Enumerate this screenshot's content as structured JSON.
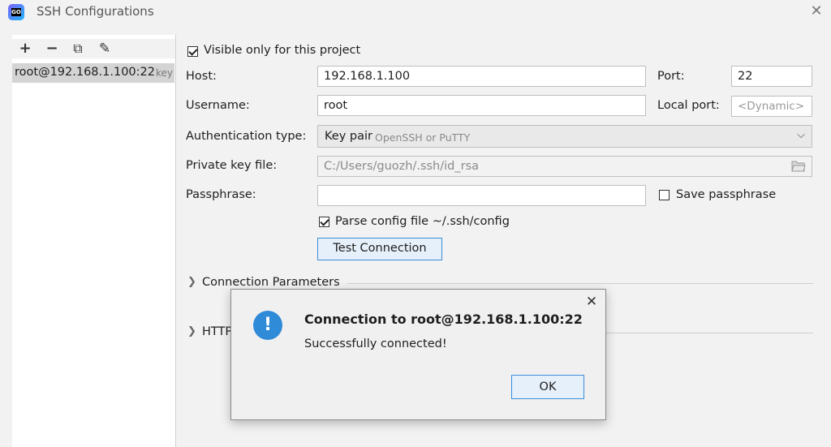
{
  "window": {
    "title": "SSH Configurations",
    "close_glyph": "✕"
  },
  "app_icon_text": "GO",
  "toolbar": {
    "add": "+",
    "remove": "−",
    "copy": "⧉",
    "edit": "✎"
  },
  "config_list": [
    {
      "name": "root@192.168.1.100:22",
      "tag": "key"
    }
  ],
  "form": {
    "visible_only": {
      "label": "Visible only for this project",
      "checked": true
    },
    "host": {
      "label": "Host:",
      "value": "192.168.1.100"
    },
    "port": {
      "label": "Port:",
      "value": "22"
    },
    "username": {
      "label": "Username:",
      "value": "root"
    },
    "local_port": {
      "label": "Local port:",
      "placeholder": "<Dynamic>"
    },
    "auth_type": {
      "label": "Authentication type:",
      "value": "Key pair",
      "hint": "OpenSSH or PuTTY"
    },
    "private_key": {
      "label": "Private key file:",
      "value": "C:/Users/guozh/.ssh/id_rsa"
    },
    "passphrase": {
      "label": "Passphrase:",
      "value": ""
    },
    "save_passphrase": {
      "label": "Save passphrase",
      "checked": false
    },
    "parse_config": {
      "label": "Parse config file ~/.ssh/config",
      "checked": true
    },
    "test_button": "Test Connection"
  },
  "sections": {
    "connection_params": "Connection Parameters",
    "http": "HTTP"
  },
  "dialog": {
    "title": "Connection to root@192.168.1.100:22",
    "message": "Successfully connected!",
    "ok": "OK",
    "close_glyph": "✕",
    "icon_glyph": "!"
  }
}
